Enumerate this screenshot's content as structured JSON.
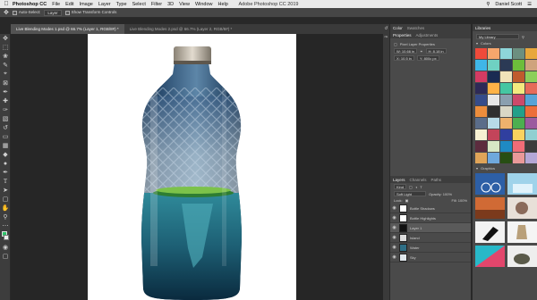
{
  "menubar": {
    "app": "Photoshop CC",
    "items": [
      "File",
      "Edit",
      "Image",
      "Layer",
      "Type",
      "Select",
      "Filter",
      "3D",
      "View",
      "Window",
      "Help"
    ],
    "window_title": "Adobe Photoshop CC 2019",
    "user": "Daniel Scott"
  },
  "options": {
    "auto_select": "Auto-Select:",
    "target": "Layer",
    "transform": "Show Transform Controls"
  },
  "tabs": [
    {
      "label": "Live Blending Modes 1.psd @ 66.7% (Layer 1, RGB/8#) *",
      "active": true
    },
    {
      "label": "Live Blending Modes 2.psd @ 66.7% (Layer 2, RGB/8#) *",
      "active": false
    }
  ],
  "properties": {
    "tabs": [
      "Color",
      "Swatches"
    ],
    "subtabs": [
      "Properties",
      "Adjustments"
    ],
    "kind": "Pixel Layer Properties",
    "w": "W: 10.66 in",
    "h": "H: 8.18 in",
    "x": "X: 10.5 in",
    "y": "Y: 800c px"
  },
  "libraries": {
    "title": "Libraries",
    "library_name": "My Library",
    "colors_label": "Colors",
    "graphics_label": "Graphics",
    "swatch_colors": [
      "#ef4a3a",
      "#f6a66c",
      "#8ed6d9",
      "#6c8f80",
      "#e8a73c",
      "#3fb6e8",
      "#6fd1c2",
      "#2b3a55",
      "#6dbd3b",
      "#cfa37d",
      "#d33b63",
      "#1a2b52",
      "#f1e3b8",
      "#c05b2d",
      "#8ccf5a",
      "#2e2a57",
      "#ffb347",
      "#45c6a2",
      "#f2ea7f",
      "#e66b5a",
      "#364c8a",
      "#e7e7e7",
      "#8a9faf",
      "#cc4a6b",
      "#57a3d7",
      "#ec8d3c",
      "#2f2f2f",
      "#d9d7c6",
      "#22a08a",
      "#ec6e3a",
      "#5b6d8a",
      "#b8dbe8",
      "#eeb26d",
      "#4caf50",
      "#9c5b9f",
      "#f7f0d2",
      "#c3445a",
      "#303f9f",
      "#f9d25e",
      "#8fcfd1",
      "#5c2c3e",
      "#d8e7c5",
      "#1f8ac3",
      "#f16c77",
      "#3c3c3c",
      "#e0a458",
      "#6fa8dc",
      "#274e13",
      "#ea9999",
      "#b4a7d6"
    ]
  },
  "layers": {
    "tabs": [
      "Layers",
      "Channels",
      "Paths"
    ],
    "kind": "Kind",
    "blend_mode": "Soft Light",
    "opacity": "Opacity: 100%",
    "fill": "Fill: 100%",
    "lock": "Lock:",
    "items": [
      {
        "name": "Bottle Shadows",
        "selected": false
      },
      {
        "name": "Bottle Highlights",
        "selected": false
      },
      {
        "name": "Layer 1",
        "selected": true
      },
      {
        "name": "Island",
        "selected": false
      },
      {
        "name": "Water",
        "selected": false
      },
      {
        "name": "Sky",
        "selected": false
      }
    ]
  }
}
